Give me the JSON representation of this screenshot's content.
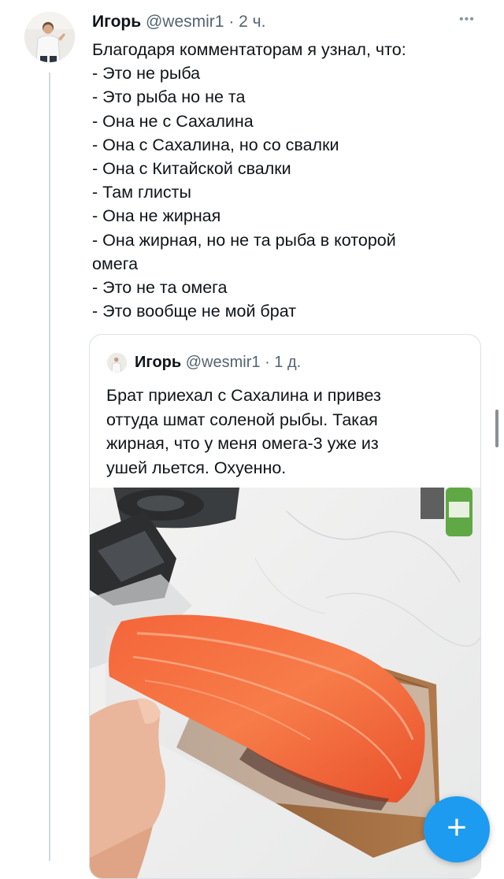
{
  "tweet": {
    "author_name": "Игорь",
    "handle": "@wesmir1",
    "time": "· 2 ч.",
    "more_icon": "ellipsis-icon",
    "lines": [
      "Благодаря комментаторам я узнал, что:",
      "- Это не рыба",
      "- Это рыба но не та",
      "- Она не с Сахалина",
      "- Она с Сахалина, но со свалки",
      "- Она с Китайской свалки",
      "- Там глисты",
      "- Она не жирная",
      "- Она жирная,  но не та рыба в которой",
      "омега",
      "- Это не та омега",
      "- Это вообще не мой брат"
    ]
  },
  "quoted_tweet": {
    "author_name": "Игорь",
    "handle": "@wesmir1",
    "time": "· 1 д.",
    "lines": [
      "Брат приехал с Сахалина и привез",
      "оттуда шмат соленой рыбы. Такая",
      "жирная, что у меня омега-3 уже из",
      "ушей льется. Охуенно."
    ],
    "photo": "salted-fish-fillet-on-cutting-board"
  },
  "compose_button": {
    "label": "+",
    "icon": "plus-icon",
    "color": "#1d9bf0"
  }
}
